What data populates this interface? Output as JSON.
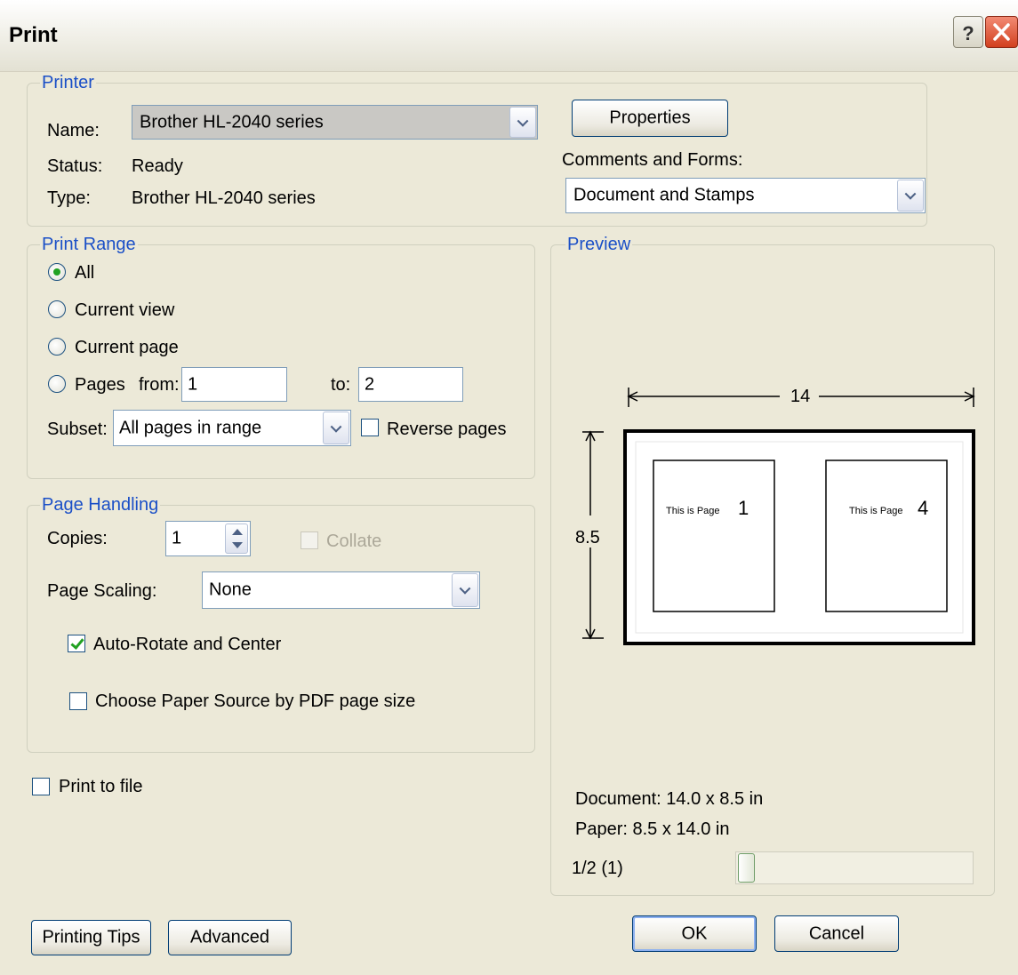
{
  "window": {
    "title": "Print",
    "help_label": "?",
    "close_label": "X"
  },
  "printer": {
    "legend": "Printer",
    "name_label": "Name:",
    "name_value": "Brother HL-2040 series",
    "status_label": "Status:",
    "status_value": "Ready",
    "type_label": "Type:",
    "type_value": "Brother HL-2040 series",
    "properties_button": "Properties",
    "comments_label": "Comments and Forms:",
    "comments_value": "Document and Stamps"
  },
  "print_range": {
    "legend": "Print Range",
    "options": [
      {
        "label": "All",
        "selected": true
      },
      {
        "label": "Current view",
        "selected": false
      },
      {
        "label": "Current page",
        "selected": false
      },
      {
        "label": "Pages",
        "selected": false
      }
    ],
    "from_label": "from:",
    "from_value": "1",
    "to_label": "to:",
    "to_value": "2",
    "subset_label": "Subset:",
    "subset_value": "All pages in range",
    "reverse_label": "Reverse pages",
    "reverse_checked": false
  },
  "page_handling": {
    "legend": "Page Handling",
    "copies_label": "Copies:",
    "copies_value": "1",
    "collate_label": "Collate",
    "collate_enabled": false,
    "scaling_label": "Page Scaling:",
    "scaling_value": "None",
    "auto_rotate_label": "Auto-Rotate and Center",
    "auto_rotate_checked": true,
    "paper_source_label": "Choose Paper Source by PDF page size",
    "paper_source_checked": false
  },
  "print_to_file": {
    "label": "Print to file",
    "checked": false
  },
  "preview": {
    "legend": "Preview",
    "width_dim": "14",
    "height_dim": "8.5",
    "page_left_text": "This is Page",
    "page_left_num": "1",
    "page_right_text": "This is Page",
    "page_right_num": "4",
    "document_size": "Document: 14.0 x 8.5 in",
    "paper_size": "Paper: 8.5 x 14.0 in",
    "page_indicator": "1/2 (1)",
    "slider_position": 0
  },
  "buttons": {
    "printing_tips": "Printing Tips",
    "advanced": "Advanced",
    "ok": "OK",
    "cancel": "Cancel"
  },
  "colors": {
    "background": "#ece9d8",
    "legend": "#1a4fc7",
    "field_border": "#7f9db9",
    "check_green": "#21a121"
  }
}
